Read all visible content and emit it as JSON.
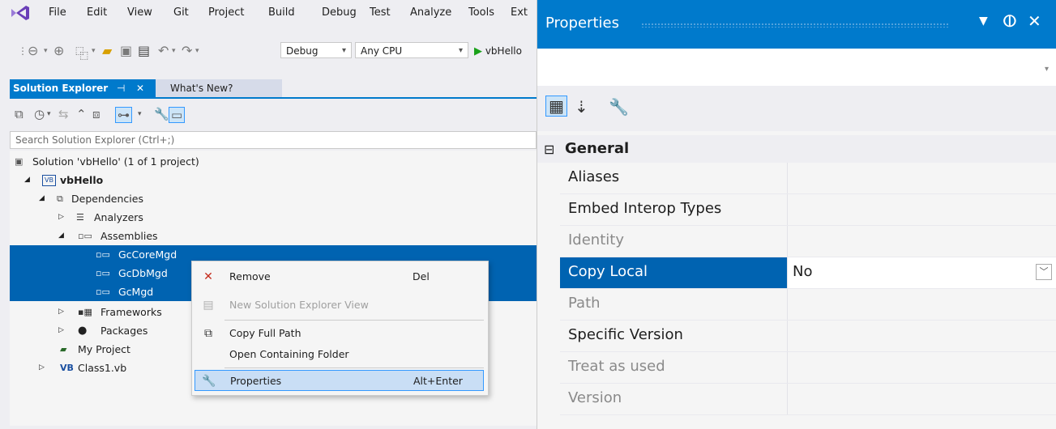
{
  "menu": [
    "File",
    "Edit",
    "View",
    "Git",
    "Project",
    "Build",
    "Debug",
    "Test",
    "Analyze",
    "Tools",
    "Ext"
  ],
  "toolbar": {
    "config": "Debug",
    "platform": "Any CPU",
    "run_label": "vbHello"
  },
  "tabs": {
    "solution_explorer": "Solution Explorer",
    "pin": "⊣",
    "close": "✕",
    "whats_new": "What's New?"
  },
  "search": {
    "placeholder": "Search Solution Explorer (Ctrl+;)"
  },
  "tree": [
    {
      "label": "Solution 'vbHello' (1 of 1 project)",
      "icon": "solution-icon",
      "expander": ""
    },
    {
      "label": "vbHello",
      "icon": "vb-project-icon",
      "expander": "◢",
      "bold": true
    },
    {
      "label": "Dependencies",
      "icon": "dependencies-icon",
      "expander": "◢"
    },
    {
      "label": "Analyzers",
      "icon": "analyzers-icon",
      "expander": "▷"
    },
    {
      "label": "Assemblies",
      "icon": "assemblies-icon",
      "expander": "◢"
    },
    {
      "label": "GcCoreMgd",
      "icon": "assembly-ref-icon",
      "expander": "",
      "selected": true
    },
    {
      "label": "GcDbMgd",
      "icon": "assembly-ref-icon",
      "expander": "",
      "selected": true
    },
    {
      "label": "GcMgd",
      "icon": "assembly-ref-icon",
      "expander": "",
      "selected": true
    },
    {
      "label": "Frameworks",
      "icon": "frameworks-icon",
      "expander": "▷"
    },
    {
      "label": "Packages",
      "icon": "packages-icon",
      "expander": "▷"
    },
    {
      "label": "My Project",
      "icon": "my-project-icon",
      "expander": ""
    },
    {
      "label": "Class1.vb",
      "icon": "vb-file-icon",
      "expander": "▷"
    }
  ],
  "vb_badge": "VB",
  "context_menu": [
    {
      "label": "Remove",
      "shortcut": "Del",
      "icon": "remove-icon"
    },
    {
      "label": "New Solution Explorer View",
      "shortcut": "",
      "icon": "new-view-icon",
      "disabled": true
    },
    {
      "label": "Copy Full Path",
      "shortcut": "",
      "icon": "copy-icon"
    },
    {
      "label": "Open Containing Folder",
      "shortcut": "",
      "icon": ""
    },
    {
      "label": "Properties",
      "shortcut": "Alt+Enter",
      "icon": "wrench-icon",
      "highlighted": true
    }
  ],
  "properties": {
    "title": "Properties",
    "category": "General",
    "rows": [
      {
        "name": "Aliases",
        "value": "",
        "dim": false
      },
      {
        "name": "Embed Interop Types",
        "value": "",
        "dim": false
      },
      {
        "name": "Identity",
        "value": "",
        "dim": true
      },
      {
        "name": "Copy Local",
        "value": "No",
        "dim": false,
        "selected": true
      },
      {
        "name": "Path",
        "value": "",
        "dim": true
      },
      {
        "name": "Specific Version",
        "value": "",
        "dim": false
      },
      {
        "name": "Treat as used",
        "value": "",
        "dim": true
      },
      {
        "name": "Version",
        "value": "",
        "dim": true
      }
    ]
  },
  "colors": {
    "accent": "#007acc",
    "selection": "#0063b1",
    "menu_hot": "#c9def5"
  }
}
